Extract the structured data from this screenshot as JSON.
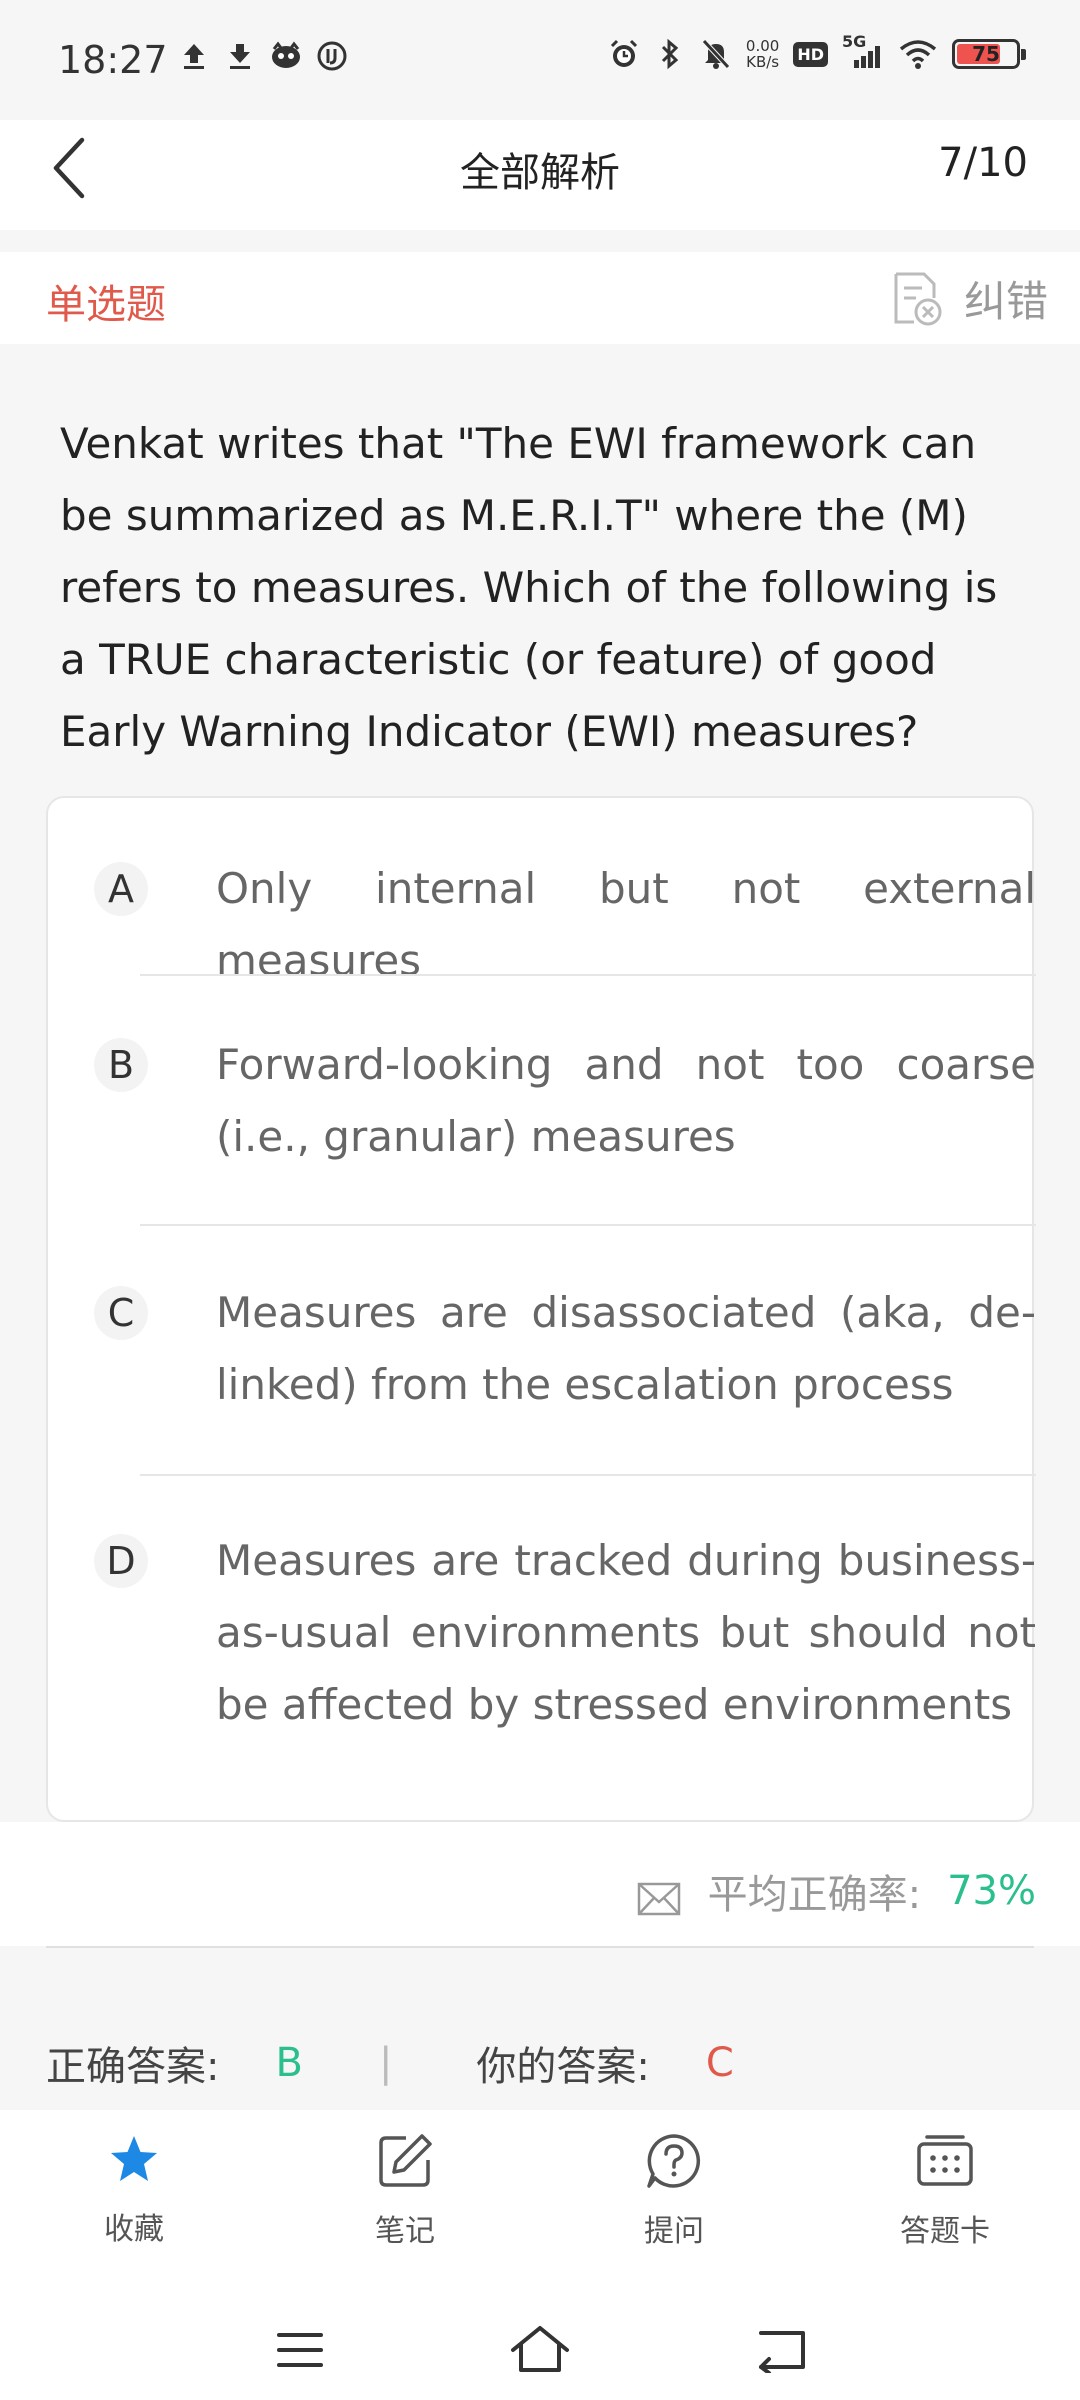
{
  "status_bar": {
    "time": "18:27",
    "net_speed_value": "0.00",
    "net_speed_unit": "KB/s",
    "hd_label": "HD",
    "signal_label": "5G",
    "battery_level": "75",
    "battery_color": "#ef5350"
  },
  "header": {
    "title": "全部解析",
    "progress": "7/10"
  },
  "question": {
    "type_label": "单选题",
    "report_error_label": "纠错",
    "text": "Venkat writes that \"The EWI framework can be summarized as M.E.R.I.T\" where the (M) refers to measures. Which of the following is a TRUE characteristic (or feature) of good Early Warning Indicator (EWI) measures?",
    "options": [
      {
        "letter": "A",
        "text": "Only internal but not external measures"
      },
      {
        "letter": "B",
        "text": "Forward-looking and not too coarse (i.e., granular) measures"
      },
      {
        "letter": "C",
        "text": "Measures are disassociated (aka, de-linked) from the escalation process"
      },
      {
        "letter": "D",
        "text": "Measures are tracked during business-as-usual environments but should not be affected by stressed environments"
      }
    ]
  },
  "stats": {
    "accuracy_label": "平均正确率:",
    "accuracy_value": "73%"
  },
  "answers": {
    "correct_label": "正确答案:",
    "correct_value": "B",
    "separator": "|",
    "yours_label": "你的答案:",
    "yours_value": "C"
  },
  "tabs": [
    {
      "label": "收藏",
      "icon": "star-icon"
    },
    {
      "label": "笔记",
      "icon": "edit-note-icon"
    },
    {
      "label": "提问",
      "icon": "question-icon"
    },
    {
      "label": "答题卡",
      "icon": "answer-card-icon"
    }
  ],
  "colors": {
    "accent_red": "#e05a4b",
    "accent_green": "#2bbf8e",
    "favorite_blue": "#1e88e5"
  }
}
